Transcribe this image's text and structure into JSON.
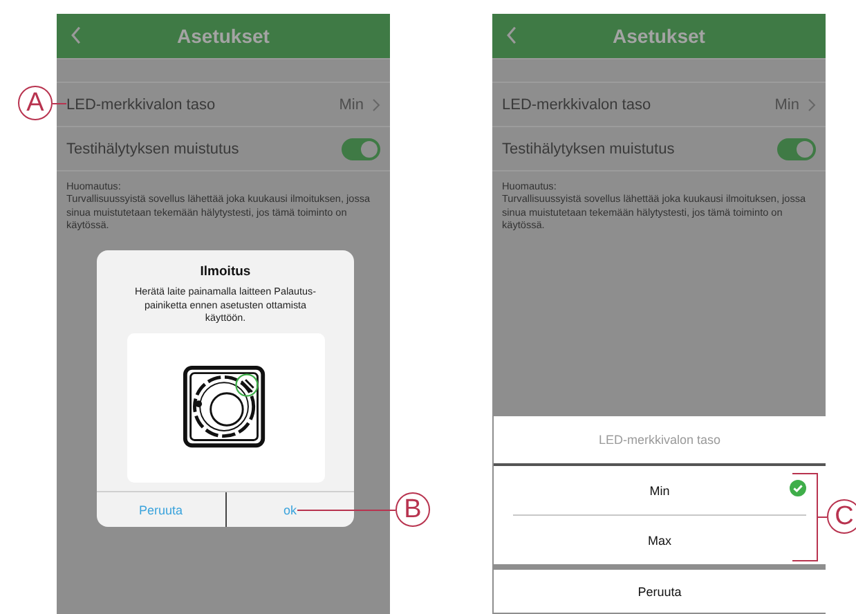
{
  "screens": [
    {
      "header": {
        "title": "Asetukset"
      },
      "rows": [
        {
          "kind": "value",
          "label": "LED-merkkivalon taso",
          "value": "Min"
        },
        {
          "kind": "toggle",
          "label": "Testihälytyksen muistutus",
          "on": true
        }
      ],
      "note": {
        "title": "Huomautus:",
        "text": "Turvallisuussyistä sovellus lähettää joka kuukausi ilmoituksen, jossa sinua muistutetaan tekemään hälytystesti, jos tämä toiminto on käytössä."
      },
      "dialog": {
        "title": "Ilmoitus",
        "message": "Herätä laite painamalla laitteen Palautus-painiketta ennen asetusten ottamista käyttöön.",
        "buttons": [
          "Peruuta",
          "ok"
        ]
      }
    },
    {
      "header": {
        "title": "Asetukset"
      },
      "rows": [
        {
          "kind": "value",
          "label": "LED-merkkivalon taso",
          "value": "Min"
        },
        {
          "kind": "toggle",
          "label": "Testihälytyksen muistutus",
          "on": true
        }
      ],
      "note": {
        "title": "Huomautus:",
        "text": "Turvallisuussyistä sovellus lähettää joka kuukausi ilmoituksen, jossa sinua muistutetaan tekemään hälytystesti, jos tämä toiminto on käytössä."
      },
      "action_sheet": {
        "title": "LED-merkkivalon taso",
        "options": [
          {
            "label": "Min",
            "selected": true
          },
          {
            "label": "Max",
            "selected": false
          }
        ],
        "cancel": "Peruuta"
      }
    }
  ],
  "callouts": [
    "A",
    "B",
    "C"
  ]
}
